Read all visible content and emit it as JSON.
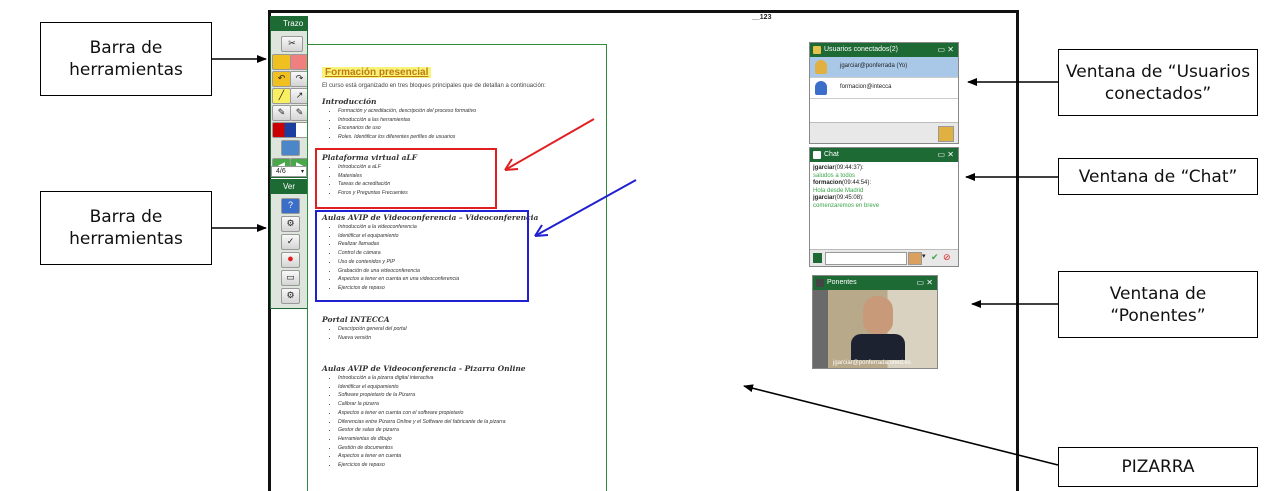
{
  "callouts": {
    "toolbar_top": "Barra de\nherramientas",
    "toolbar_bottom": "Barra de\nherramientas",
    "users_window": "Ventana de “Usuarios\nconectados”",
    "chat_window": "Ventana de “Chat”",
    "ponentes_window": "Ventana de\n“Ponentes”",
    "pizarra": "PIZARRA"
  },
  "board": {
    "page_number": "__123"
  },
  "toolbar": {
    "trazo_title": "Trazo",
    "ver_title": "Ver",
    "page_indicator": "4/6"
  },
  "document": {
    "title": "Formación presencial",
    "intro": "El curso está organizado en tres bloques principales que de detallan a continuación:",
    "sections": [
      {
        "heading": "Introducción",
        "items": [
          "Formación y acreditación, descripción del proceso formativo",
          "Introducción a las herramientas",
          "Escenarios de uso",
          "Roles. Identificar los diferentes perfiles de usuarios"
        ]
      },
      {
        "heading": "Plataforma virtual aLF",
        "items": [
          "Introducción a aLF",
          "Materiales",
          "Tareas de acreditación",
          "Foros y Preguntas Frecuentes"
        ]
      },
      {
        "heading": "Aulas AVIP de Videoconferencia – Videoconferencia",
        "items": [
          "Introducción a la videoconferencia",
          "Identificar el equipamiento",
          "Realizar llamadas",
          "Control de cámara",
          "Uso de contenidos y PIP",
          "Grabación de una videoconferencia",
          "Aspectos a tener en cuenta en una videoconferencia",
          "Ejercicios de repaso"
        ]
      },
      {
        "heading": "Portal INTECCA",
        "items": [
          "Descripción general del portal",
          "Nueva versión"
        ]
      },
      {
        "heading": "Aulas AVIP de Videoconferencia - Pizarra Online",
        "items": [
          "Introducción a la pizarra digital interactiva",
          "Identificar el equipamiento",
          "Software propietario de la Pizarra",
          "Calibrar la pizarra",
          "Aspectos a tener en cuenta con el software propietario",
          "Diferencias entre Pizarra Online y el Software del fabricante de la pizarra",
          "Gestor de salas de pizarra",
          "Herramientas de dibujo",
          "Gestión de documentos",
          "Aspectos a tener en cuenta",
          "Ejercicios de repaso"
        ]
      }
    ]
  },
  "users_window": {
    "title": "Usuarios conectados(2)",
    "users": [
      {
        "name": "jgarciar@ponferrada (Yo)"
      },
      {
        "name": "formacion@intecca"
      }
    ]
  },
  "chat_window": {
    "title": "Chat",
    "messages": [
      {
        "author": "jgarciar",
        "time": "(09:44:37):",
        "text": "saludos a todos"
      },
      {
        "author": "formacion",
        "time": "(09:44:54):",
        "text": "Hola desde Madrid"
      },
      {
        "author": "jgarciar",
        "time": "(09:45:08):",
        "text": "comenzaremos en breve"
      }
    ]
  },
  "ponentes_window": {
    "title": "Ponentes",
    "caption": "jgarciar@ponferrada.uned.es"
  },
  "colors": {
    "window_green": "#1e6a35",
    "highlight_yellow": "#f8f47a",
    "annotation_red": "#e02020",
    "annotation_blue": "#2020d0",
    "chat_text_green": "#3aa64a"
  }
}
